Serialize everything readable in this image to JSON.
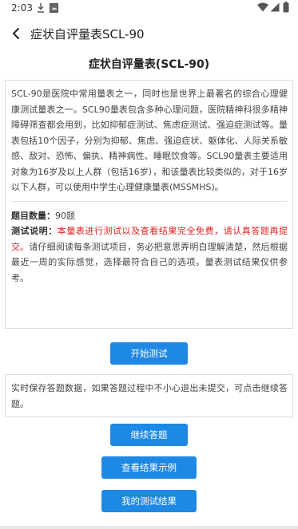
{
  "status_bar": {
    "time": "2:03",
    "icons": [
      "download-icon",
      "media-icon",
      "wifi-icon",
      "signal-icon",
      "battery-icon"
    ]
  },
  "app_bar": {
    "back_icon": "chevron-left-icon",
    "title": "症状自评量表SCL-90"
  },
  "page": {
    "title": "症状自评量表(SCL-90)",
    "intro": "SCL-90是医院中常用量表之一，同时也是世界上最著名的综合心理健康测试量表之一。SCL90量表包含多种心理问题，医院精神科很多精神障碍筛查都会用到，比如抑郁症测试、焦虑症测试、强迫症测试等。量表包括10个因子，分别为抑郁、焦虑、强迫症状、躯体化、人际关系敏感、敌对、恐怖、偏执、精神病性、睡眠饮食等。SCL90量表主要适用对象为16岁及以上人群（包括16岁），和该量表比较类似的，对于16岁以下人群，可以使用中学生心理健康量表(MSSMHS)。",
    "count_label": "题目数量：",
    "count_value": "90题",
    "desc_label": "测试说明：",
    "desc_red": "本量表进行测试以及查看结果完全免费，请认真答题再提交。",
    "desc_normal": "请仔细阅读每条测试项目，务必把意思弄明白理解清楚，然后根据最近一周的实际感觉，选择最符合自己的选项。量表测试结果仅供参考。",
    "start_button": "开始测试",
    "save_note": "实时保存答题数据，如果答题过程中不小心退出未提交，可点击继续答题。",
    "continue_button": "继续答题",
    "example_button": "查看结果示例",
    "results_button": "我的测试结果"
  },
  "colors": {
    "accent": "#1e88e5",
    "warning_text": "#e02020"
  }
}
